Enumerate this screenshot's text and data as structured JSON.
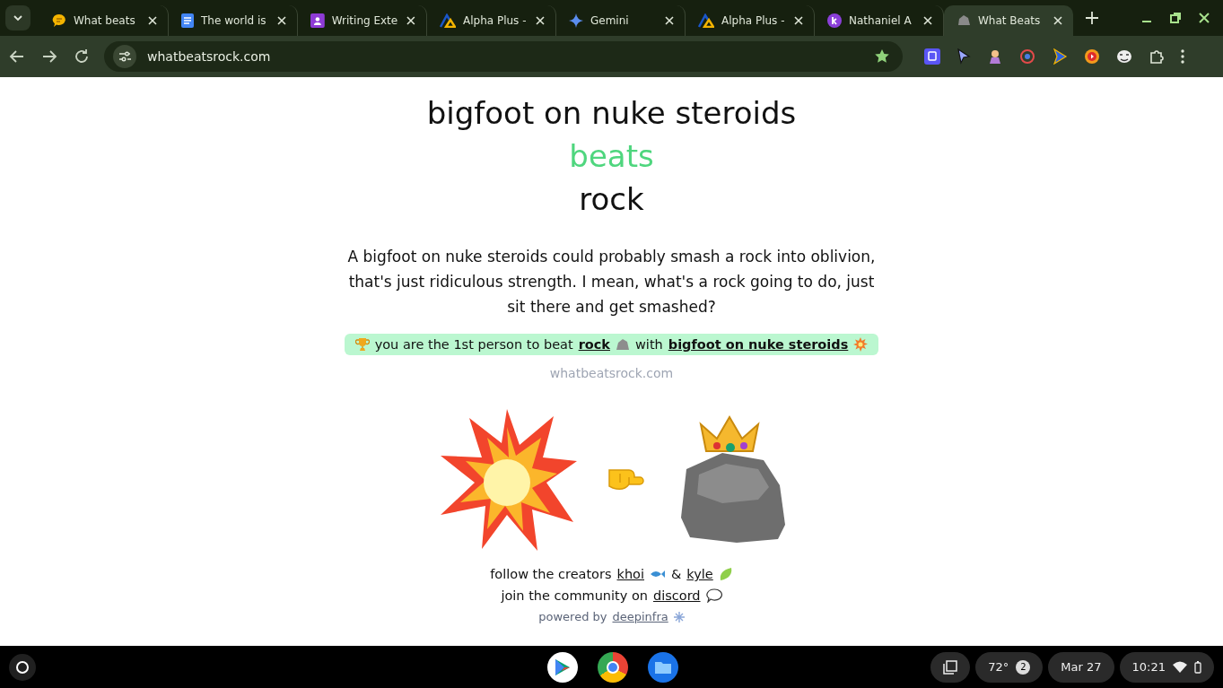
{
  "tabs": [
    {
      "title": "What beats",
      "selected": false
    },
    {
      "title": "The world is",
      "selected": false
    },
    {
      "title": "Writing Exte",
      "selected": false
    },
    {
      "title": "Alpha Plus -",
      "selected": false
    },
    {
      "title": "Gemini",
      "selected": false
    },
    {
      "title": "Alpha Plus -",
      "selected": false
    },
    {
      "title": "Nathaniel A",
      "selected": false
    },
    {
      "title": "What Beats",
      "selected": true
    }
  ],
  "address": "whatbeatsrock.com",
  "game": {
    "guess": "bigfoot on nuke steroids",
    "verb": "beats",
    "target": "rock",
    "explanation": "A bigfoot on nuke steroids could probably smash a rock into oblivion, that's just ridiculous strength. I mean, what's a rock going to do, just sit there and get smashed?",
    "banner": {
      "lead": "you are the 1st person to beat",
      "target": "rock",
      "mid": "with",
      "guess": "bigfoot on nuke steroids"
    },
    "watermark": "whatbeatsrock.com"
  },
  "footer": {
    "follow": "follow the creators",
    "creator_1": "khoi",
    "amp": "&",
    "creator_2": "kyle",
    "join": "join the community on",
    "discord": "discord",
    "powered": "powered by",
    "sponsor": "deepinfra"
  },
  "taskbar": {
    "weather": "72°",
    "notifications": "2",
    "date": "Mar 27",
    "time": "10:21"
  }
}
